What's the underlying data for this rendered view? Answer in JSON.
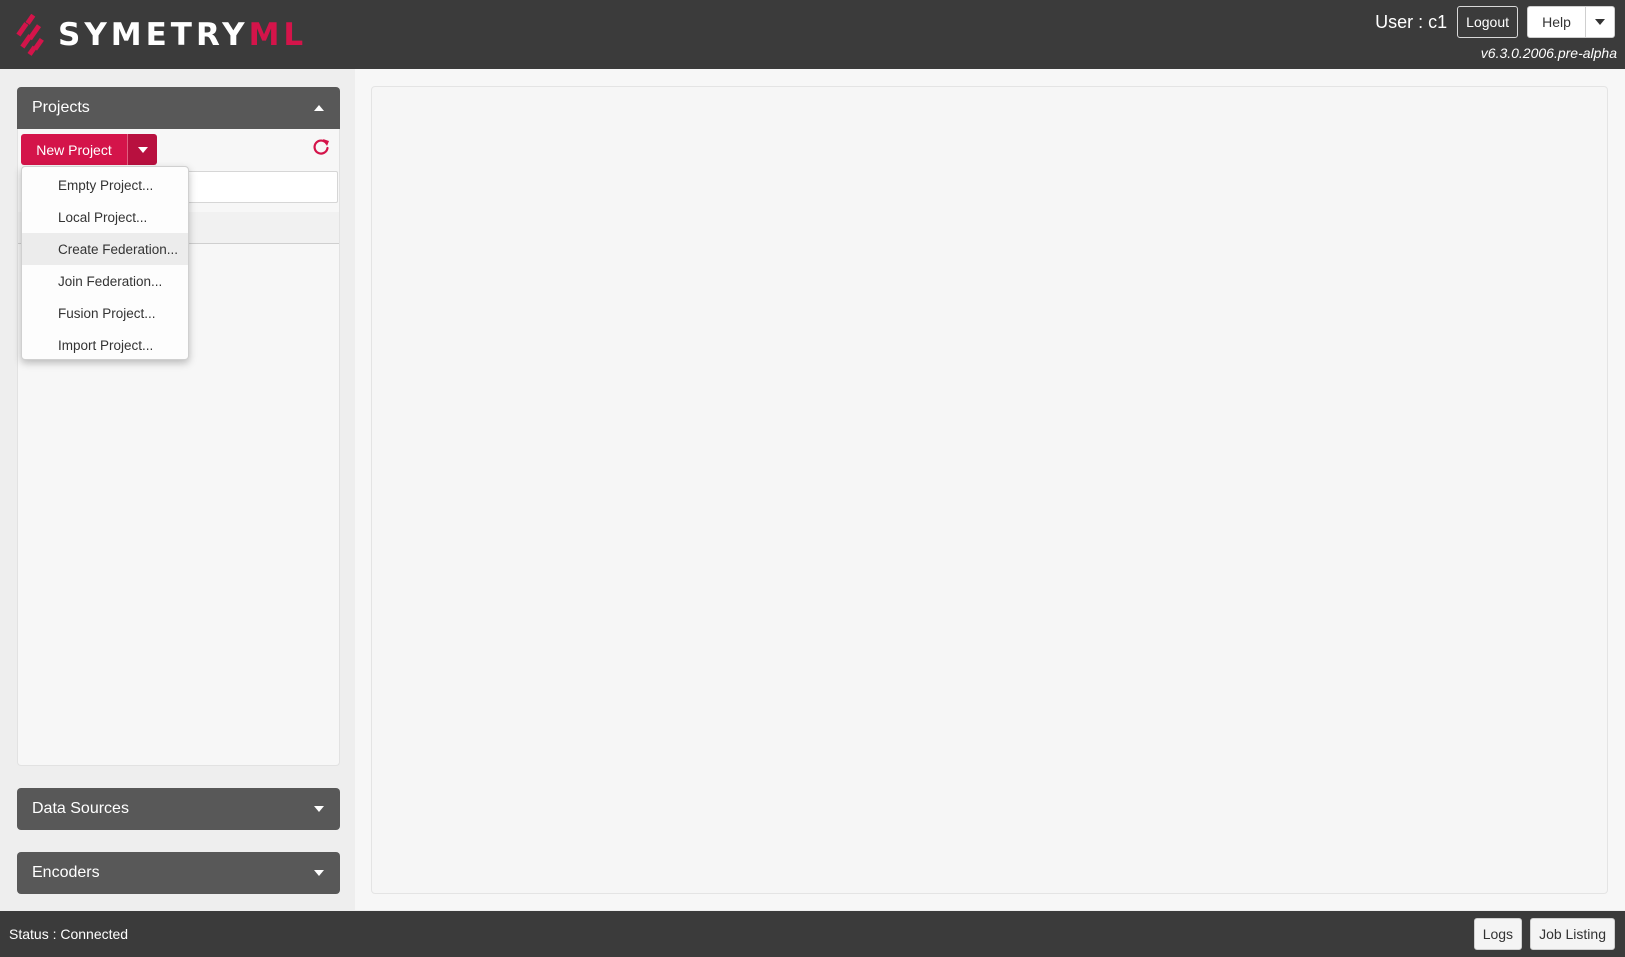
{
  "header": {
    "logo_text_white": "SYMETRY",
    "logo_text_red": "ML",
    "user_label": "User : c1",
    "logout_label": "Logout",
    "help_label": "Help",
    "version": "v6.3.0.2006.pre-alpha"
  },
  "sidebar": {
    "projects": {
      "title": "Projects",
      "new_project_label": "New Project",
      "menu_items": [
        "Empty Project...",
        "Local Project...",
        "Create Federation...",
        "Join Federation...",
        "Fusion Project...",
        "Import Project..."
      ]
    },
    "data_sources_title": "Data Sources",
    "encoders_title": "Encoders"
  },
  "footer": {
    "status": "Status : Connected",
    "logs_label": "Logs",
    "job_listing_label": "Job Listing"
  },
  "colors": {
    "accent": "#d4144a",
    "header_bg": "#3b3b3b",
    "accordion_bg": "#585858"
  }
}
